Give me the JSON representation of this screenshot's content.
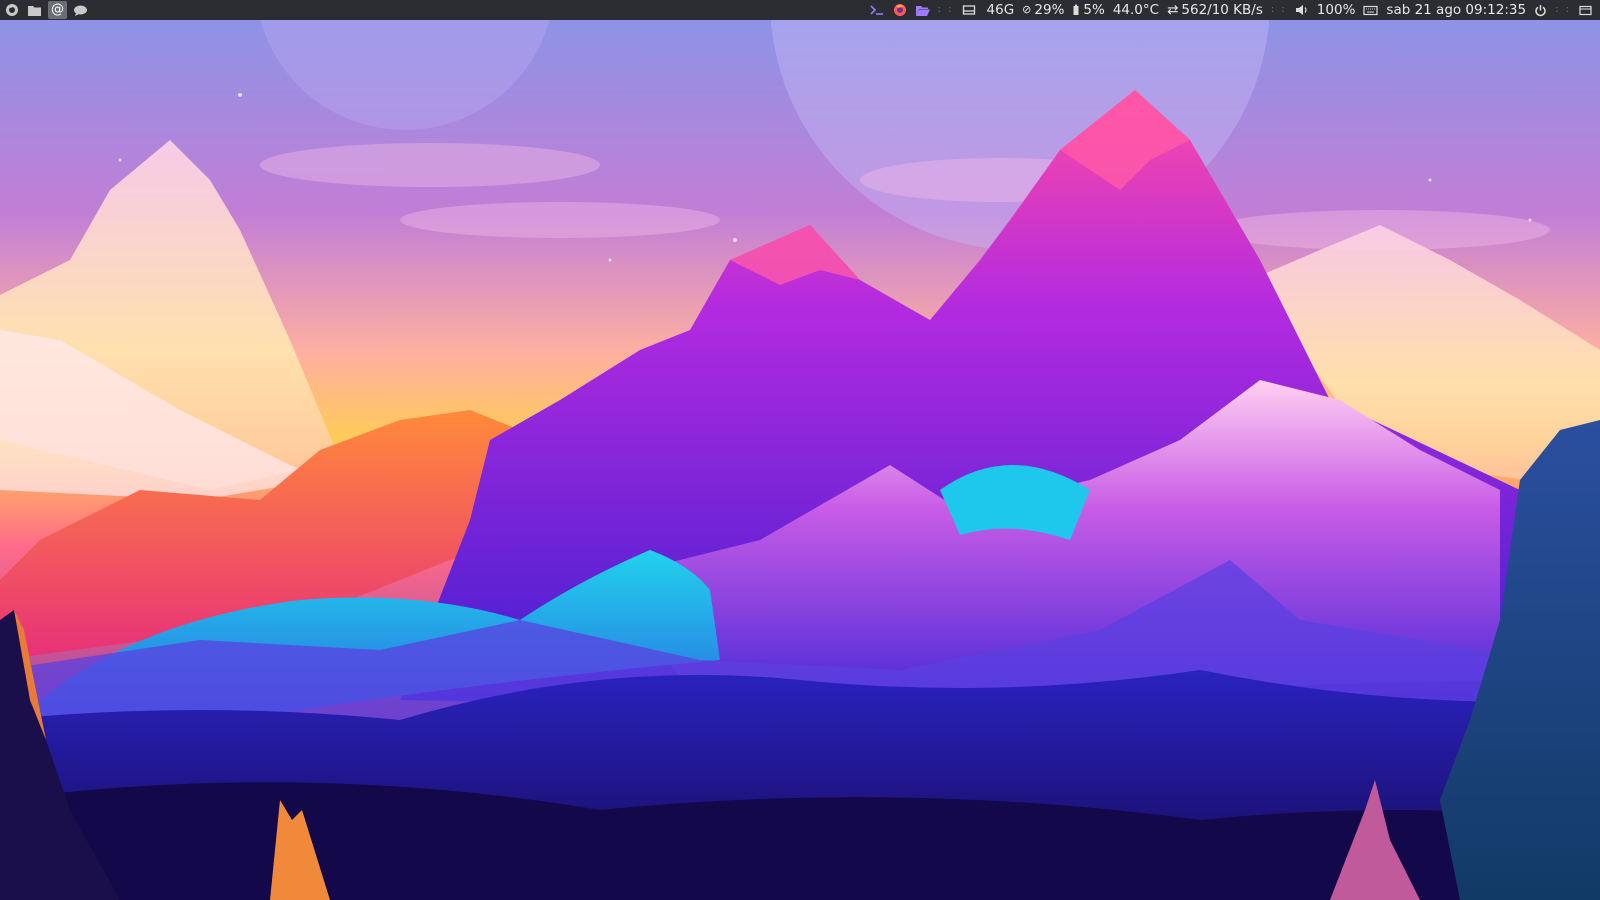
{
  "panel": {
    "left_launchers": [
      {
        "icon": "firefox-icon"
      },
      {
        "icon": "folder-icon"
      },
      {
        "icon": "at-sign-icon",
        "active": true
      },
      {
        "icon": "chat-bubble-icon"
      }
    ],
    "status": {
      "disk": "46G",
      "cpu": "29%",
      "battery": "5%",
      "temperature": "44.0°C",
      "network": "562/10 KB/s",
      "volume": "100%",
      "datetime": "sab 21 ago 09:12:35"
    },
    "icon_colors": {
      "terminal": "#8a7dff",
      "firefox": "#ff5a5a",
      "files": "#a07aff"
    }
  },
  "wallpaper": {
    "colors": {
      "sky_top": "#8d93e6",
      "sky_mid": "#c27ed6",
      "sky_sunset": "#ffcc55",
      "peak_pink": "#ff4aa6",
      "peak_violet": "#6b2ae0",
      "lake_cyan": "#21d2ec",
      "valley_blue": "#1f1ca8",
      "foreground": "#150a55"
    }
  }
}
